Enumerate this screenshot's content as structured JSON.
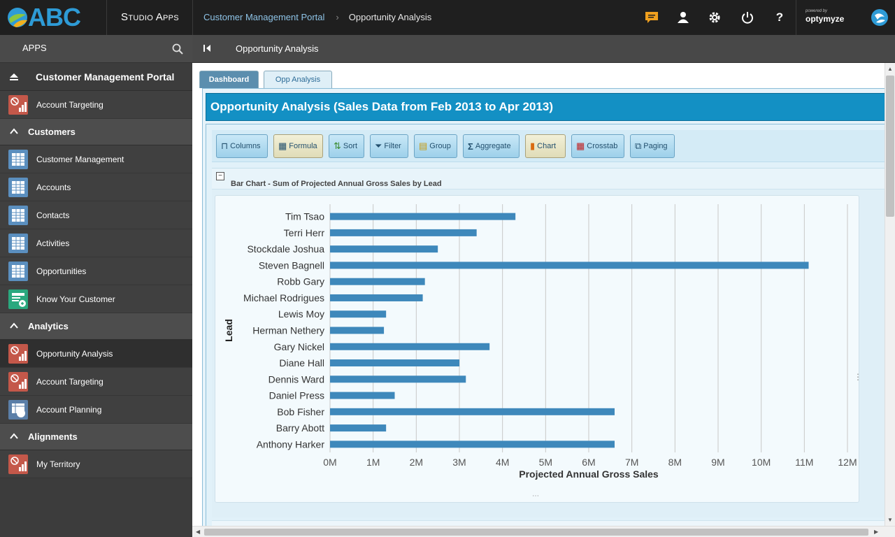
{
  "topbar": {
    "logo_text": "ABC",
    "studio_label": "Studio Apps",
    "breadcrumb": [
      "Customer Management Portal",
      "Opportunity Analysis"
    ],
    "breadcrumb_separator": "›",
    "icons": [
      "chat-icon",
      "user-icon",
      "gear-icon",
      "power-icon",
      "help-icon"
    ],
    "help_glyph": "?",
    "brand_powered": "powered by",
    "brand_name": "optymyze"
  },
  "sidebar": {
    "apps_label": "APPS",
    "portal_label": "Customer Management Portal",
    "sections": [
      {
        "label": "Customers"
      },
      {
        "label": "Analytics"
      },
      {
        "label": "Alignments"
      }
    ],
    "items": {
      "account_targeting_top": "Account Targeting",
      "customer_management": "Customer Management",
      "accounts": "Accounts",
      "contacts": "Contacts",
      "activities": "Activities",
      "opportunities": "Opportunities",
      "know_your_customer": "Know Your Customer",
      "opportunity_analysis": "Opportunity Analysis",
      "account_targeting": "Account Targeting",
      "account_planning": "Account Planning",
      "my_territory": "My Territory"
    }
  },
  "subbar": {
    "title": "Opportunity Analysis"
  },
  "tabs": {
    "dashboard": "Dashboard",
    "opp": "Opp Analysis"
  },
  "panel": {
    "title": "Opportunity Analysis (Sales Data from Feb 2013 to Apr 2013)"
  },
  "toolbar": {
    "columns": "Columns",
    "formula": "Formula",
    "sort": "Sort",
    "filter": "Filter",
    "group": "Group",
    "aggregate": "Aggregate",
    "chart": "Chart",
    "crosstab": "Crosstab",
    "paging": "Paging"
  },
  "chart_header": "Bar Chart - Sum of Projected Annual Gross Sales by Lead",
  "colors": {
    "accent": "#1390c4",
    "bar": "#3e88bb",
    "topbar": "#1f1f1f",
    "sidebar": "#3c3c3c"
  },
  "chart_data": {
    "type": "bar",
    "orientation": "horizontal",
    "categories": [
      "Tim Tsao",
      "Terri Herr",
      "Stockdale Joshua",
      "Steven Bagnell",
      "Robb Gary",
      "Michael Rodrigues",
      "Lewis Moy",
      "Herman Nethery",
      "Gary Nickel",
      "Diane Hall",
      "Dennis Ward",
      "Daniel Press",
      "Bob Fisher",
      "Barry Abott",
      "Anthony Harker"
    ],
    "values": [
      4300000,
      3400000,
      2500000,
      11100000,
      2200000,
      2150000,
      1300000,
      1250000,
      3700000,
      3000000,
      3150000,
      1500000,
      6600000,
      1300000,
      6600000
    ],
    "xlabel": "Projected Annual Gross Sales",
    "ylabel": "Lead",
    "xlim": [
      0,
      12000000
    ],
    "xticks": [
      "0M",
      "1M",
      "2M",
      "3M",
      "4M",
      "5M",
      "6M",
      "7M",
      "8M",
      "9M",
      "10M",
      "11M",
      "12M"
    ],
    "grid": true
  }
}
